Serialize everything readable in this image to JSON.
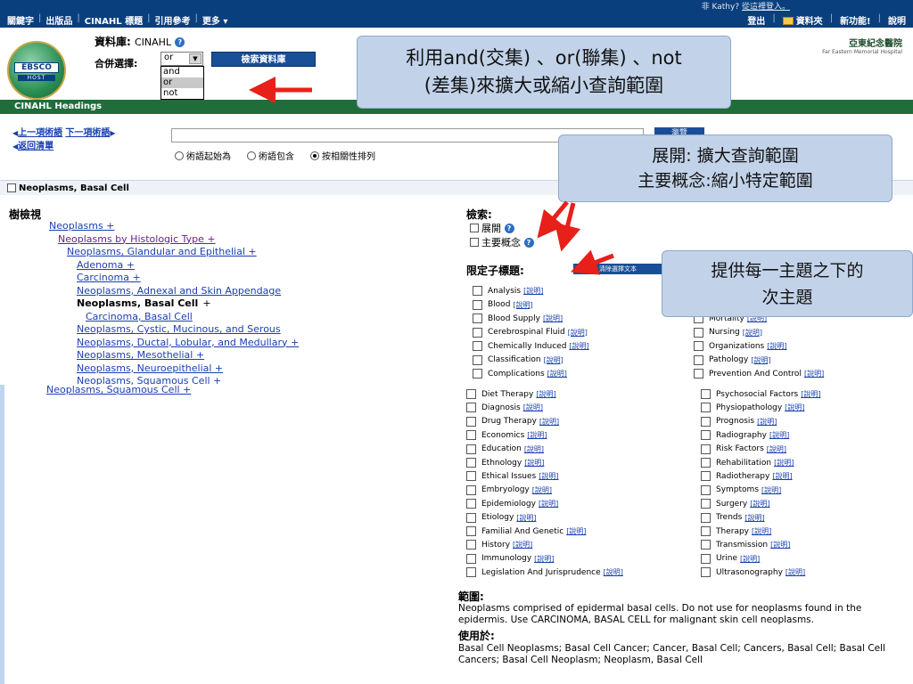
{
  "topbar": {
    "nav": [
      "關鍵字",
      "出版品",
      "CINAHL 標題",
      "引用參考",
      "更多 ▾"
    ],
    "user_prefix": "非 Kathy?",
    "login_link": "從這裡登入。",
    "logout": "登出",
    "folder": "資料夾",
    "new_features": "新功能!",
    "help": "說明"
  },
  "header": {
    "logo_text": "EBSCO",
    "logo_sub": "HOST",
    "db_label": "資料庫:",
    "db_value": "CINAHL",
    "combine_label": "合併選擇:",
    "combine_value": "or",
    "combine_options": [
      "and",
      "or",
      "not"
    ],
    "search_db_button": "檢索資料庫",
    "partner_name": "亞東紀念醫院",
    "partner_sub": "Far Eastern Memorial Hospital"
  },
  "headings_bar": "CINAHL Headings",
  "term_nav": {
    "prev": "上一項術語",
    "next": "下一項術語",
    "back": "返回清單",
    "browse_button": "瀏覽",
    "radios": [
      "術語起始為",
      "術語包含",
      "按相關性排列"
    ],
    "selected_radio": 2
  },
  "term_title": "Neoplasms, Basal Cell",
  "tree": {
    "title": "樹檢視",
    "nodes": [
      {
        "label": "Neoplasms +",
        "level": 0,
        "style": "link"
      },
      {
        "label": "Neoplasms by Histologic Type +",
        "level": 1,
        "style": "purple"
      },
      {
        "label": "Neoplasms, Glandular and Epithelial +",
        "level": 2,
        "style": "link"
      },
      {
        "label": "Adenoma +",
        "level": 3,
        "style": "link"
      },
      {
        "label": "Carcinoma +",
        "level": 3,
        "style": "link"
      },
      {
        "label": "Neoplasms, Adnexal and Skin Appendage",
        "level": 3,
        "style": "link"
      },
      {
        "label": "Neoplasms, Basal Cell",
        "level": 3,
        "style": "current",
        "suffix": "+"
      },
      {
        "label": "Carcinoma, Basal Cell",
        "level": 4,
        "style": "link"
      },
      {
        "label": "Neoplasms, Cystic, Mucinous, and Serous",
        "level": 3,
        "style": "link"
      },
      {
        "label": "Neoplasms, Ductal, Lobular, and Medullary +",
        "level": 3,
        "style": "link"
      },
      {
        "label": "Neoplasms, Mesothelial +",
        "level": 3,
        "style": "link"
      },
      {
        "label": "Neoplasms, Neuroepithelial +",
        "level": 3,
        "style": "link"
      },
      {
        "label": "Neoplasms, Squamous Cell +",
        "level": 3,
        "style": "link"
      }
    ],
    "overflow_label": "Neoplasms, Squamous Cell +"
  },
  "search": {
    "title": "檢索:",
    "expand": "展開",
    "major": "主要概念",
    "subhead_title": "限定子標題:",
    "clear_button": "清除選擇文本",
    "explain": "[說明]"
  },
  "subheadings_left": [
    "Analysis",
    "Blood",
    "Blood Supply",
    "Cerebrospinal Fluid",
    "Chemically Induced",
    "Classification",
    "Complications",
    "Diet Therapy",
    "Diagnosis",
    "Drug Therapy",
    "Economics",
    "Education",
    "Ethnology",
    "Ethical Issues",
    "Embryology",
    "Epidemiology",
    "Etiology",
    "Familial And Genetic",
    "History",
    "Immunology",
    "Legislation And Jurisprudence"
  ],
  "subheadings_right": [
    "Mortality",
    "Nursing",
    "Organizations",
    "Pathology",
    "Prevention And Control",
    "Psychosocial Factors",
    "Physiopathology",
    "Prognosis",
    "Radiography",
    "Risk Factors",
    "Rehabilitation",
    "Radiotherapy",
    "Symptoms",
    "Surgery",
    "Trends",
    "Therapy",
    "Transmission",
    "Urine",
    "Ultrasonography"
  ],
  "scope": {
    "title": "範圍:",
    "text": "Neoplasms comprised of epidermal basal cells. Do not use for neoplasms found in the epidermis. Use CARCINOMA, BASAL CELL for malignant skin cell neoplasms."
  },
  "used_for": {
    "title": "使用於:",
    "text": "Basal Cell Neoplasms; Basal Cell Cancer; Cancer, Basal Cell; Cancers, Basal Cell; Basal Cell Cancers; Basal Cell Neoplasm; Neoplasm, Basal Cell"
  },
  "callouts": {
    "c1_line1": "利用and(交集) 、or(聯集) 、not",
    "c1_line2": "(差集)來擴大或縮小查詢範圍",
    "c2_line1": "展開: 擴大查詢範圍",
    "c2_line2": "主要概念:縮小特定範圍",
    "c3_line1": "提供每一主題之下的",
    "c3_line2": "次主題"
  },
  "colors": {
    "topbar": "#0a3f7e",
    "headings_bar": "#1e6d3a",
    "callout_bg": "#c2d3e9",
    "arrow": "#e8201a",
    "link": "#1a3fb0"
  }
}
